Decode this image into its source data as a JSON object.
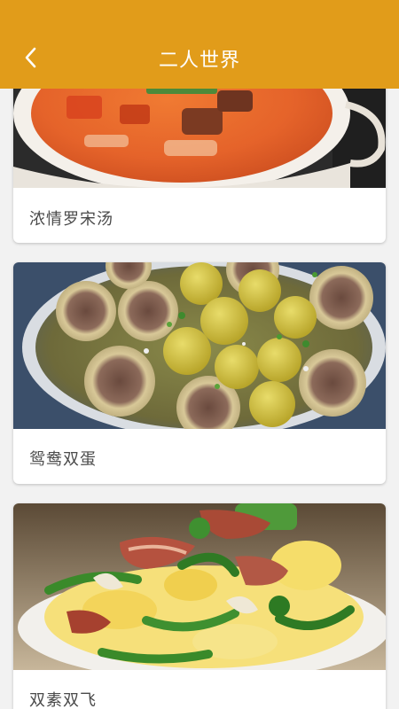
{
  "app_bar": {
    "title": "二人世界",
    "back_icon": "chevron-left-icon",
    "background_color": "#e19c1a"
  },
  "recipes": [
    {
      "name": "浓情罗宋汤",
      "image": "tomato-beef-soup-image"
    },
    {
      "name": "鸳鸯双蛋",
      "image": "braised-eggs-in-broth-image"
    },
    {
      "name": "双素双飞",
      "image": "scrambled-eggs-bacon-peppers-image"
    }
  ]
}
